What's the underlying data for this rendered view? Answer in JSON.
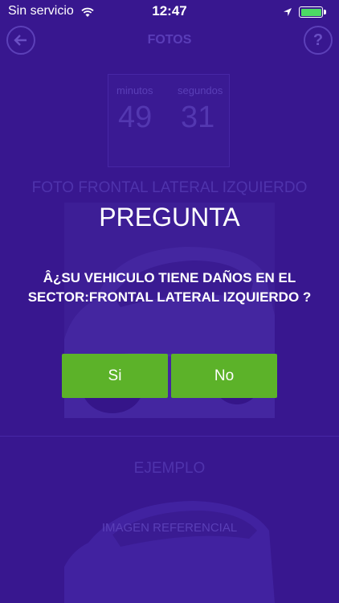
{
  "status_bar": {
    "carrier": "Sin servicio",
    "time": "12:47",
    "battery_color": "#4cd964"
  },
  "nav": {
    "title": "FOTOS",
    "back_icon": "back-arrow-icon",
    "help_label": "?"
  },
  "timer": {
    "minutes_label": "minutos",
    "seconds_label": "segundos",
    "minutes": "49",
    "seconds": "31"
  },
  "photo_section": {
    "title": "FOTO FRONTAL LATERAL IZQUIERDO"
  },
  "example_section": {
    "title": "EJEMPLO",
    "caption": "IMAGEN REFERENCIAL"
  },
  "dialog": {
    "title": "PREGUNTA",
    "message": "Â¿SU VEHICULO TIENE DAÑOS EN EL SECTOR:FRONTAL LATERAL IZQUIERDO ?",
    "yes_label": "Si",
    "no_label": "No",
    "button_color": "#5cb229"
  },
  "colors": {
    "overlay_background": "#38178f"
  }
}
